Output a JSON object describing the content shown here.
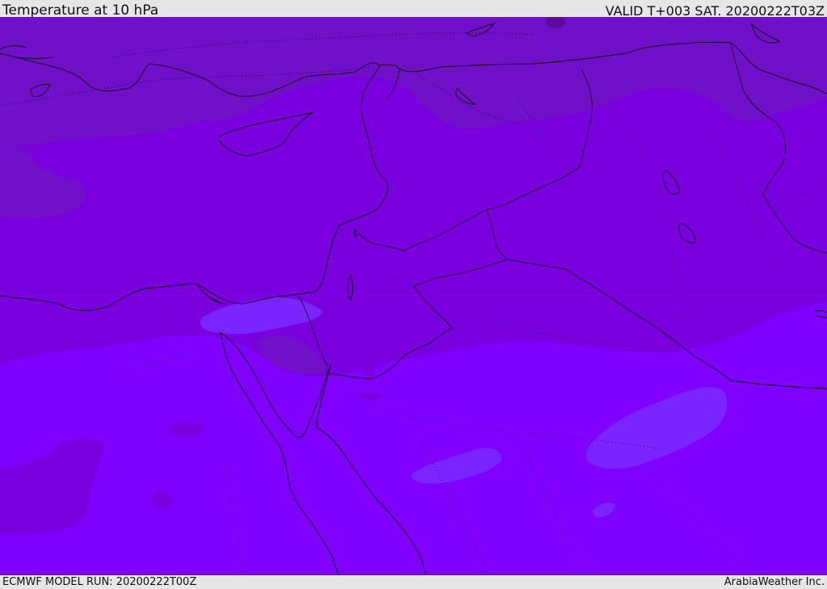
{
  "header": {
    "title": "Temperature at 10 hPa",
    "valid": "VALID T+003 SAT. 20200222T03Z"
  },
  "footer": {
    "model_run": "ECMWF MODEL RUN: 20200222T00Z",
    "credit": "ArabiaWeather Inc."
  },
  "map": {
    "colors": {
      "deep": "#7010c8",
      "mid": "#7a00e0",
      "light": "#7f00ff",
      "lighter": "#7a24ff",
      "darkspot": "#5e0a9a",
      "coast": "#111111"
    }
  }
}
